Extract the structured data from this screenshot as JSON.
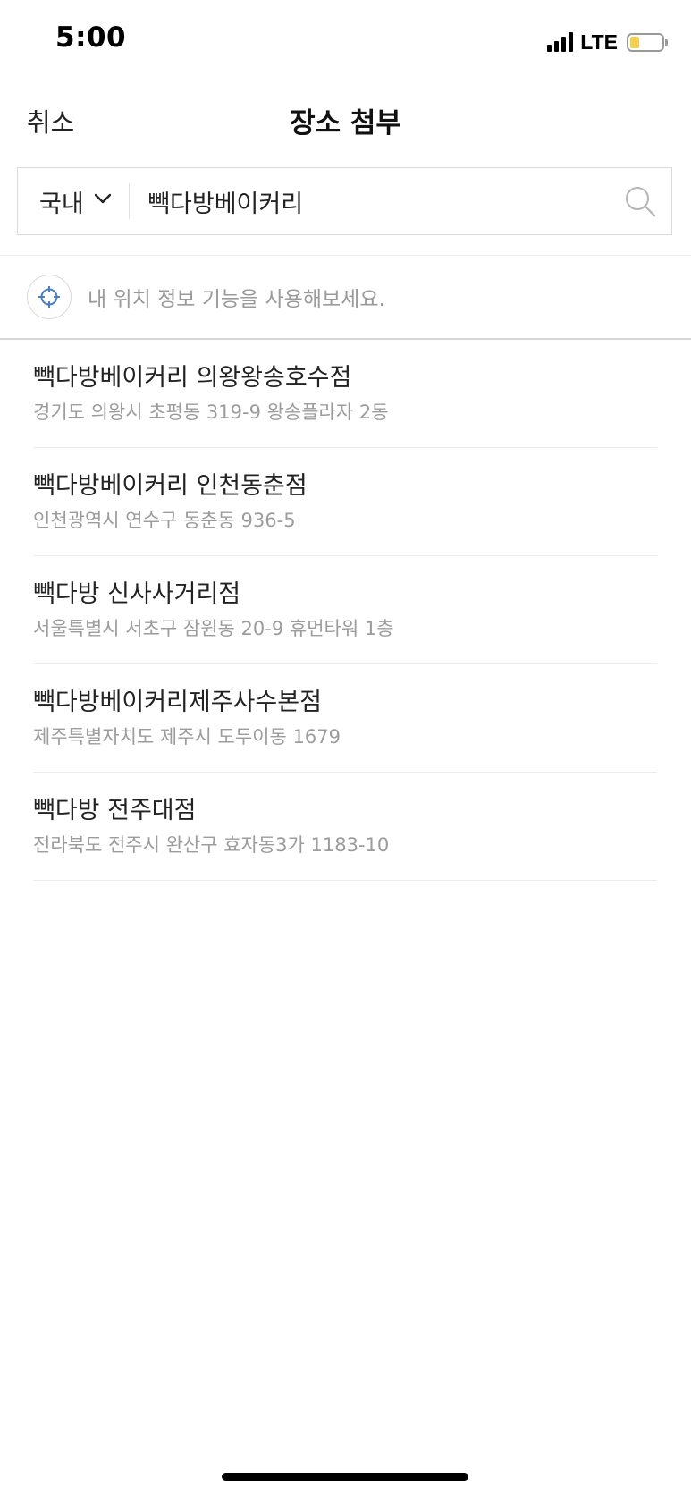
{
  "status_bar": {
    "time": "5:00",
    "network": "LTE",
    "battery_level": 0.3,
    "battery_color": "#f7cf4f",
    "icons": [
      "signal-icon",
      "battery-icon"
    ]
  },
  "header": {
    "cancel_label": "취소",
    "title": "장소 첨부"
  },
  "search": {
    "region_label": "국내",
    "region_icon": "chevron-down-icon",
    "query": "빽다방베이커리",
    "search_icon": "search-icon"
  },
  "location_banner": {
    "icon": "crosshair-icon",
    "icon_color": "#4a7fc1",
    "prompt": "내 위치 정보 기능을 사용해보세요."
  },
  "results": [
    {
      "name": "빽다방베이커리 의왕왕송호수점",
      "address": "경기도 의왕시 초평동 319-9 왕송플라자 2동"
    },
    {
      "name": "빽다방베이커리 인천동춘점",
      "address": "인천광역시 연수구 동춘동 936-5"
    },
    {
      "name": "빽다방 신사사거리점",
      "address": "서울특별시 서초구 잠원동 20-9 휴먼타워 1층"
    },
    {
      "name": "빽다방베이커리제주사수본점",
      "address": "제주특별자치도 제주시 도두이동 1679"
    },
    {
      "name": "빽다방 전주대점",
      "address": "전라북도 전주시 완산구 효자동3가 1183-10"
    }
  ]
}
